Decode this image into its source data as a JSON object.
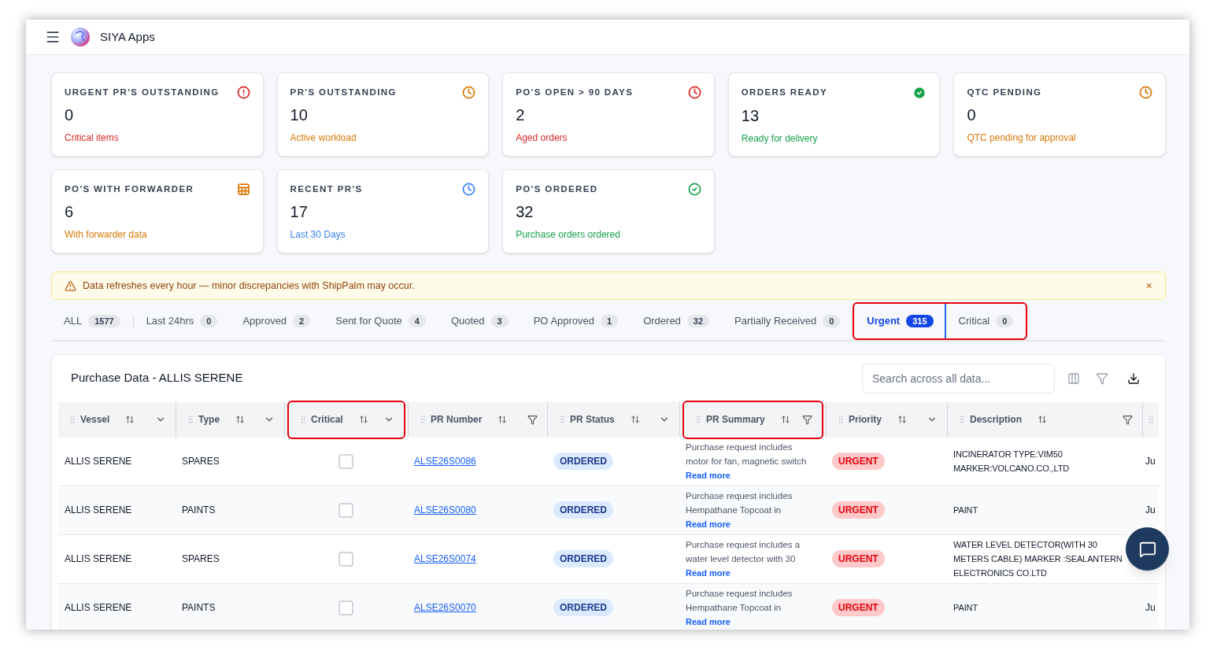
{
  "app": {
    "title": "SIYA Apps"
  },
  "cards": [
    {
      "title": "URGENT PR'S OUTSTANDING",
      "value": "0",
      "caption": "Critical items",
      "color": "#dc2626",
      "kind": "alert"
    },
    {
      "title": "PR'S OUTSTANDING",
      "value": "10",
      "caption": "Active workload",
      "color": "#d97706",
      "kind": "clock"
    },
    {
      "title": "PO'S OPEN > 90 DAYS",
      "value": "2",
      "caption": "Aged orders",
      "color": "#dc2626",
      "kind": "clock"
    },
    {
      "title": "ORDERS READY",
      "value": "13",
      "caption": "Ready for delivery",
      "color": "#16a34a",
      "kind": "check"
    },
    {
      "title": "QTC PENDING",
      "value": "0",
      "caption": "QTC pending for approval",
      "color": "#d97706",
      "kind": "clock"
    },
    {
      "title": "PO'S WITH FORWARDER",
      "value": "6",
      "caption": "With forwarder data",
      "color": "#d97706",
      "kind": "list"
    },
    {
      "title": "RECENT PR'S",
      "value": "17",
      "caption": "Last 30 Days",
      "color": "#3b82f6",
      "kind": "clock"
    },
    {
      "title": "PO'S ORDERED",
      "value": "32",
      "caption": "Purchase orders ordered",
      "color": "#16a34a",
      "kind": "check-ring"
    }
  ],
  "notice": {
    "text": "Data refreshes every hour — minor discrepancies with ShipPalm may occur.",
    "close": "×"
  },
  "tabs": [
    {
      "label": "ALL",
      "count": "1577",
      "selected": false,
      "highlighted": false
    },
    {
      "label": "Last 24hrs",
      "count": "0",
      "selected": false,
      "highlighted": false
    },
    {
      "label": "Approved",
      "count": "2",
      "selected": false,
      "highlighted": false
    },
    {
      "label": "Sent for Quote",
      "count": "4",
      "selected": false,
      "highlighted": false
    },
    {
      "label": "Quoted",
      "count": "3",
      "selected": false,
      "highlighted": false
    },
    {
      "label": "PO Approved",
      "count": "1",
      "selected": false,
      "highlighted": false
    },
    {
      "label": "Ordered",
      "count": "32",
      "selected": false,
      "highlighted": false
    },
    {
      "label": "Partially Received",
      "count": "0",
      "selected": false,
      "highlighted": false
    },
    {
      "label": "Urgent",
      "count": "315",
      "selected": true,
      "highlighted": true
    },
    {
      "label": "Critical",
      "count": "0",
      "selected": false,
      "highlighted": true
    }
  ],
  "table": {
    "title": "Purchase Data - ALLIS SERENE",
    "search": {
      "placeholder": "Search across all data..."
    },
    "columns": [
      {
        "label": "Vessel",
        "kind": "menu",
        "highlighted": false
      },
      {
        "label": "Type",
        "kind": "menu",
        "highlighted": false
      },
      {
        "label": "Critical",
        "kind": "menu",
        "highlighted": true
      },
      {
        "label": "PR Number",
        "kind": "filter",
        "highlighted": false
      },
      {
        "label": "PR Status",
        "kind": "menu",
        "highlighted": false
      },
      {
        "label": "PR Summary",
        "kind": "filter",
        "highlighted": true
      },
      {
        "label": "Priority",
        "kind": "menu",
        "highlighted": false
      },
      {
        "label": "Description",
        "kind": "filter",
        "highlighted": false
      },
      {
        "kind": "none"
      }
    ],
    "rows": [
      {
        "vessel": "ALLIS SERENE",
        "type": "SPARES",
        "critical": false,
        "pr_number": "ALSE26S0086",
        "status": "ORDERED",
        "summary": "Purchase request includes motor for fan, magnetic switch",
        "read_more": "Read more",
        "priority": "URGENT",
        "description": "INCINERATOR TYPE:VIM50 MARKER:VOLCANO.CO.,LTD",
        "column_9": "Ju"
      },
      {
        "vessel": "ALLIS SERENE",
        "type": "PAINTS",
        "critical": false,
        "pr_number": "ALSE26S0080",
        "status": "ORDERED",
        "summary": "Purchase request includes Hempathane Topcoat in",
        "read_more": "Read more",
        "priority": "URGENT",
        "description": "PAINT",
        "column_9": "Ju"
      },
      {
        "vessel": "ALLIS SERENE",
        "type": "SPARES",
        "critical": false,
        "pr_number": "ALSE26S0074",
        "status": "ORDERED",
        "summary": "Purchase request includes a water level detector with 30",
        "read_more": "Read more",
        "priority": "URGENT",
        "description": "WATER LEVEL DETECTOR(WITH 30 METERS CABLE) MARKER :SEALANTERN ELECTRONICS CO.LTD"
      },
      {
        "vessel": "ALLIS SERENE",
        "type": "PAINTS",
        "critical": false,
        "pr_number": "ALSE26S0070",
        "status": "ORDERED",
        "summary": "Purchase request includes Hempathane Topcoat in",
        "read_more": "Read more",
        "priority": "URGENT",
        "description": "PAINT",
        "column_9": "Ju"
      }
    ]
  }
}
